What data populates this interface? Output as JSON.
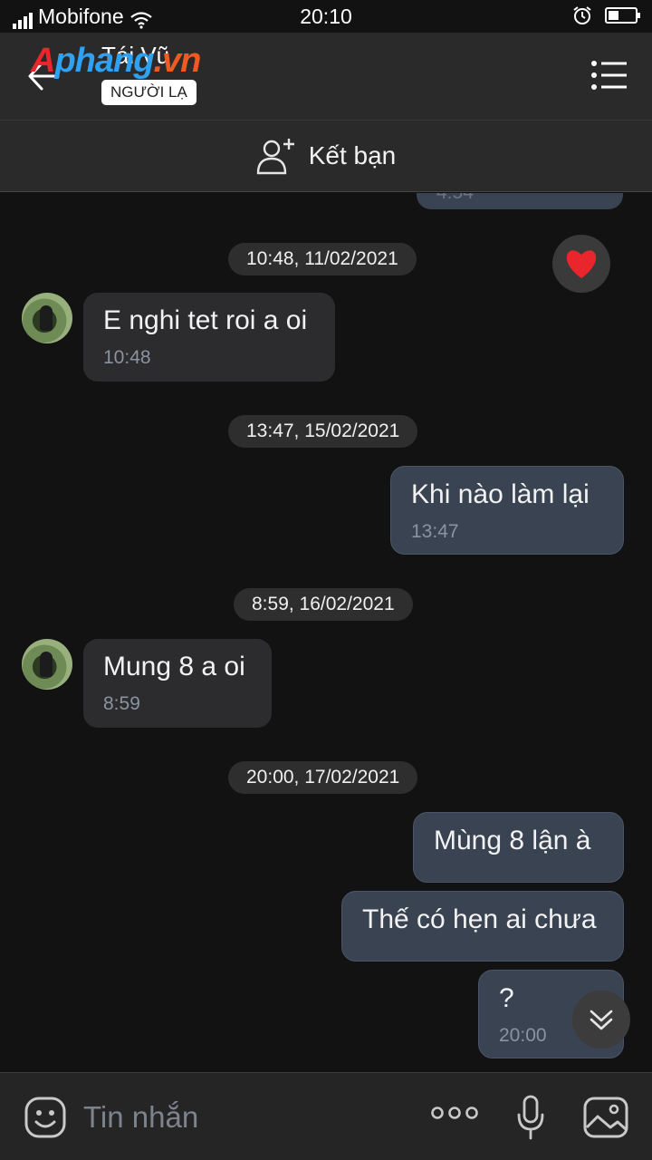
{
  "status_bar": {
    "carrier": "Mobifone",
    "time": "20:10"
  },
  "header": {
    "title": "Tái Vũ",
    "badge": "NGƯỜI LẠ",
    "watermark": {
      "part1": "A",
      "part2": "phang",
      "part3": ".vn"
    }
  },
  "friend_bar": {
    "label": "Kết bạn"
  },
  "chat": {
    "partial_time": "4:54",
    "dates": [
      "10:48, 11/02/2021",
      "13:47, 15/02/2021",
      "8:59, 16/02/2021",
      "20:00, 17/02/2021"
    ],
    "messages": [
      {
        "text": "E nghi tet roi a oi",
        "time": "10:48",
        "side": "in"
      },
      {
        "text": "Khi nào làm lại",
        "time": "13:47",
        "side": "out"
      },
      {
        "text": "Mung 8 a oi",
        "time": "8:59",
        "side": "in"
      },
      {
        "text": "Mùng 8 lận à",
        "time": "",
        "side": "out"
      },
      {
        "text": "Thế có hẹn ai chưa",
        "time": "",
        "side": "out"
      },
      {
        "text": "?",
        "time": "20:00",
        "side": "out"
      }
    ]
  },
  "input": {
    "placeholder": "Tin nhắn"
  },
  "colors": {
    "background": "#121212",
    "bar": "#2a2a2a",
    "outgoing_bubble": "#3a4352",
    "incoming_bubble": "#2c2c2e",
    "reaction": "#e8262b"
  },
  "icons": [
    "back-arrow-icon",
    "menu-list-icon",
    "add-user-icon",
    "heart-icon",
    "double-chevron-down-icon",
    "emoji-icon",
    "more-dots-icon",
    "microphone-icon",
    "image-icon"
  ]
}
